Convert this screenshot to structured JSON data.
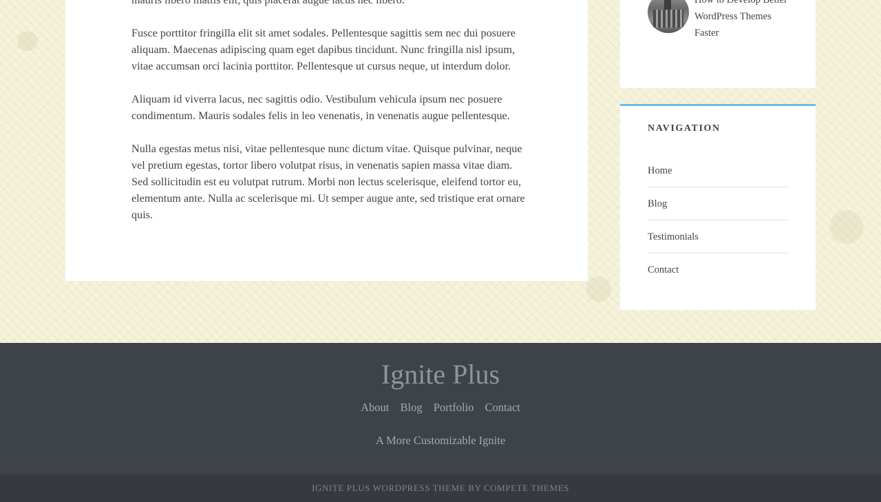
{
  "content": {
    "paragraphs": [
      "mauris libero mattis elit, quis placerat augue lacus nec libero.",
      "Fusce porttitor fringilla elit sit amet sodales. Pellentesque sagittis sem nec dui posuere aliquam. Maecenas adipiscing quam eget dapibus tincidunt. Nunc fringilla nisl ipsum, vitae accumsan orci lacinia porttitor. Pellentesque ut cursus neque, ut interdum dolor.",
      "Aliquam id viverra lacus, nec sagittis odio. Vestibulum vehicula ipsum nec posuere condimentum. Mauris sodales felis in leo venenatis, in venenatis augue pellentesque.",
      "Nulla egestas metus nisi, vitae pellentesque nunc dictum vitae. Quisque pulvinar, neque vel pretium egestas, tortor libero volutpat risus, in venenatis sapien massa vitae diam. Sed sollicitudin est eu volutpat rutrum. Morbi non lectus scelerisque, eleifend tortor eu, elementum ante. Nulla ac scelerisque mi. Ut semper augue ante, sed tristique erat ornare quis."
    ]
  },
  "sidebar": {
    "recent_post": {
      "title": "How to Develop Better WordPress Themes Faster"
    },
    "navigation": {
      "title": "NAVIGATION",
      "items": [
        "Home",
        "Blog",
        "Testimonials",
        "Contact"
      ],
      "accent_color": "#6bbde4"
    }
  },
  "footer": {
    "site_title": "Ignite Plus",
    "menu": [
      "About",
      "Blog",
      "Portfolio",
      "Contact"
    ],
    "tagline": "A More Customizable Ignite",
    "credit": "IGNITE PLUS WORDPRESS THEME BY COMPETE THEMES"
  }
}
